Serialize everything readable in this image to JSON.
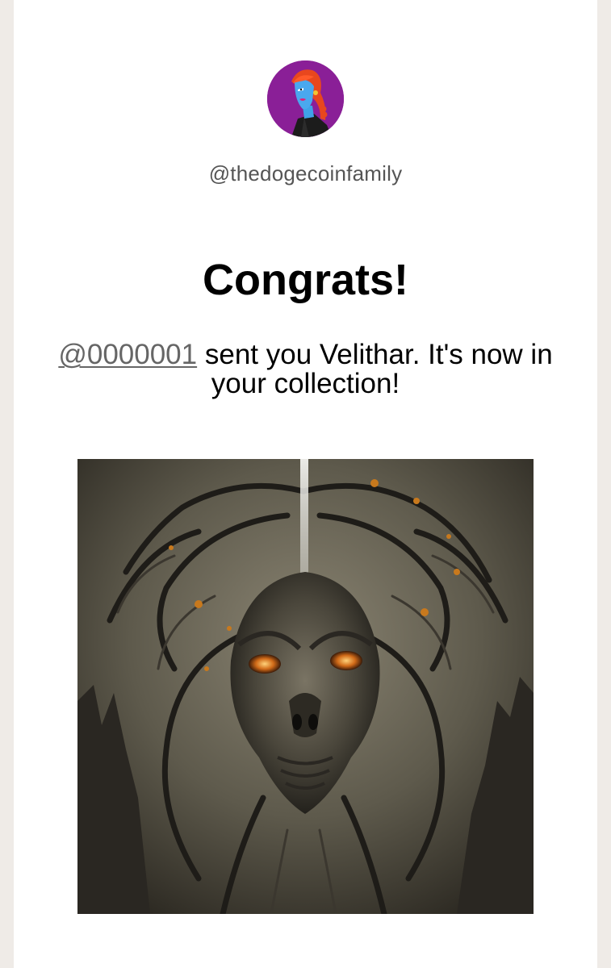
{
  "profile": {
    "avatar_icon": "profile-avatar-illustration",
    "handle": "@thedogecoinfamily"
  },
  "notification": {
    "headline": "Congrats!",
    "sender_handle": "@0000001",
    "message_text": " sent you Velithar. It's now in your collection!"
  },
  "nft": {
    "image_icon": "alien-creature-artwork"
  },
  "colors": {
    "page_background": "#efebe7",
    "card_background": "#ffffff",
    "avatar_background": "#8a1f97",
    "handle_text": "#555555",
    "link_text": "#666666"
  }
}
